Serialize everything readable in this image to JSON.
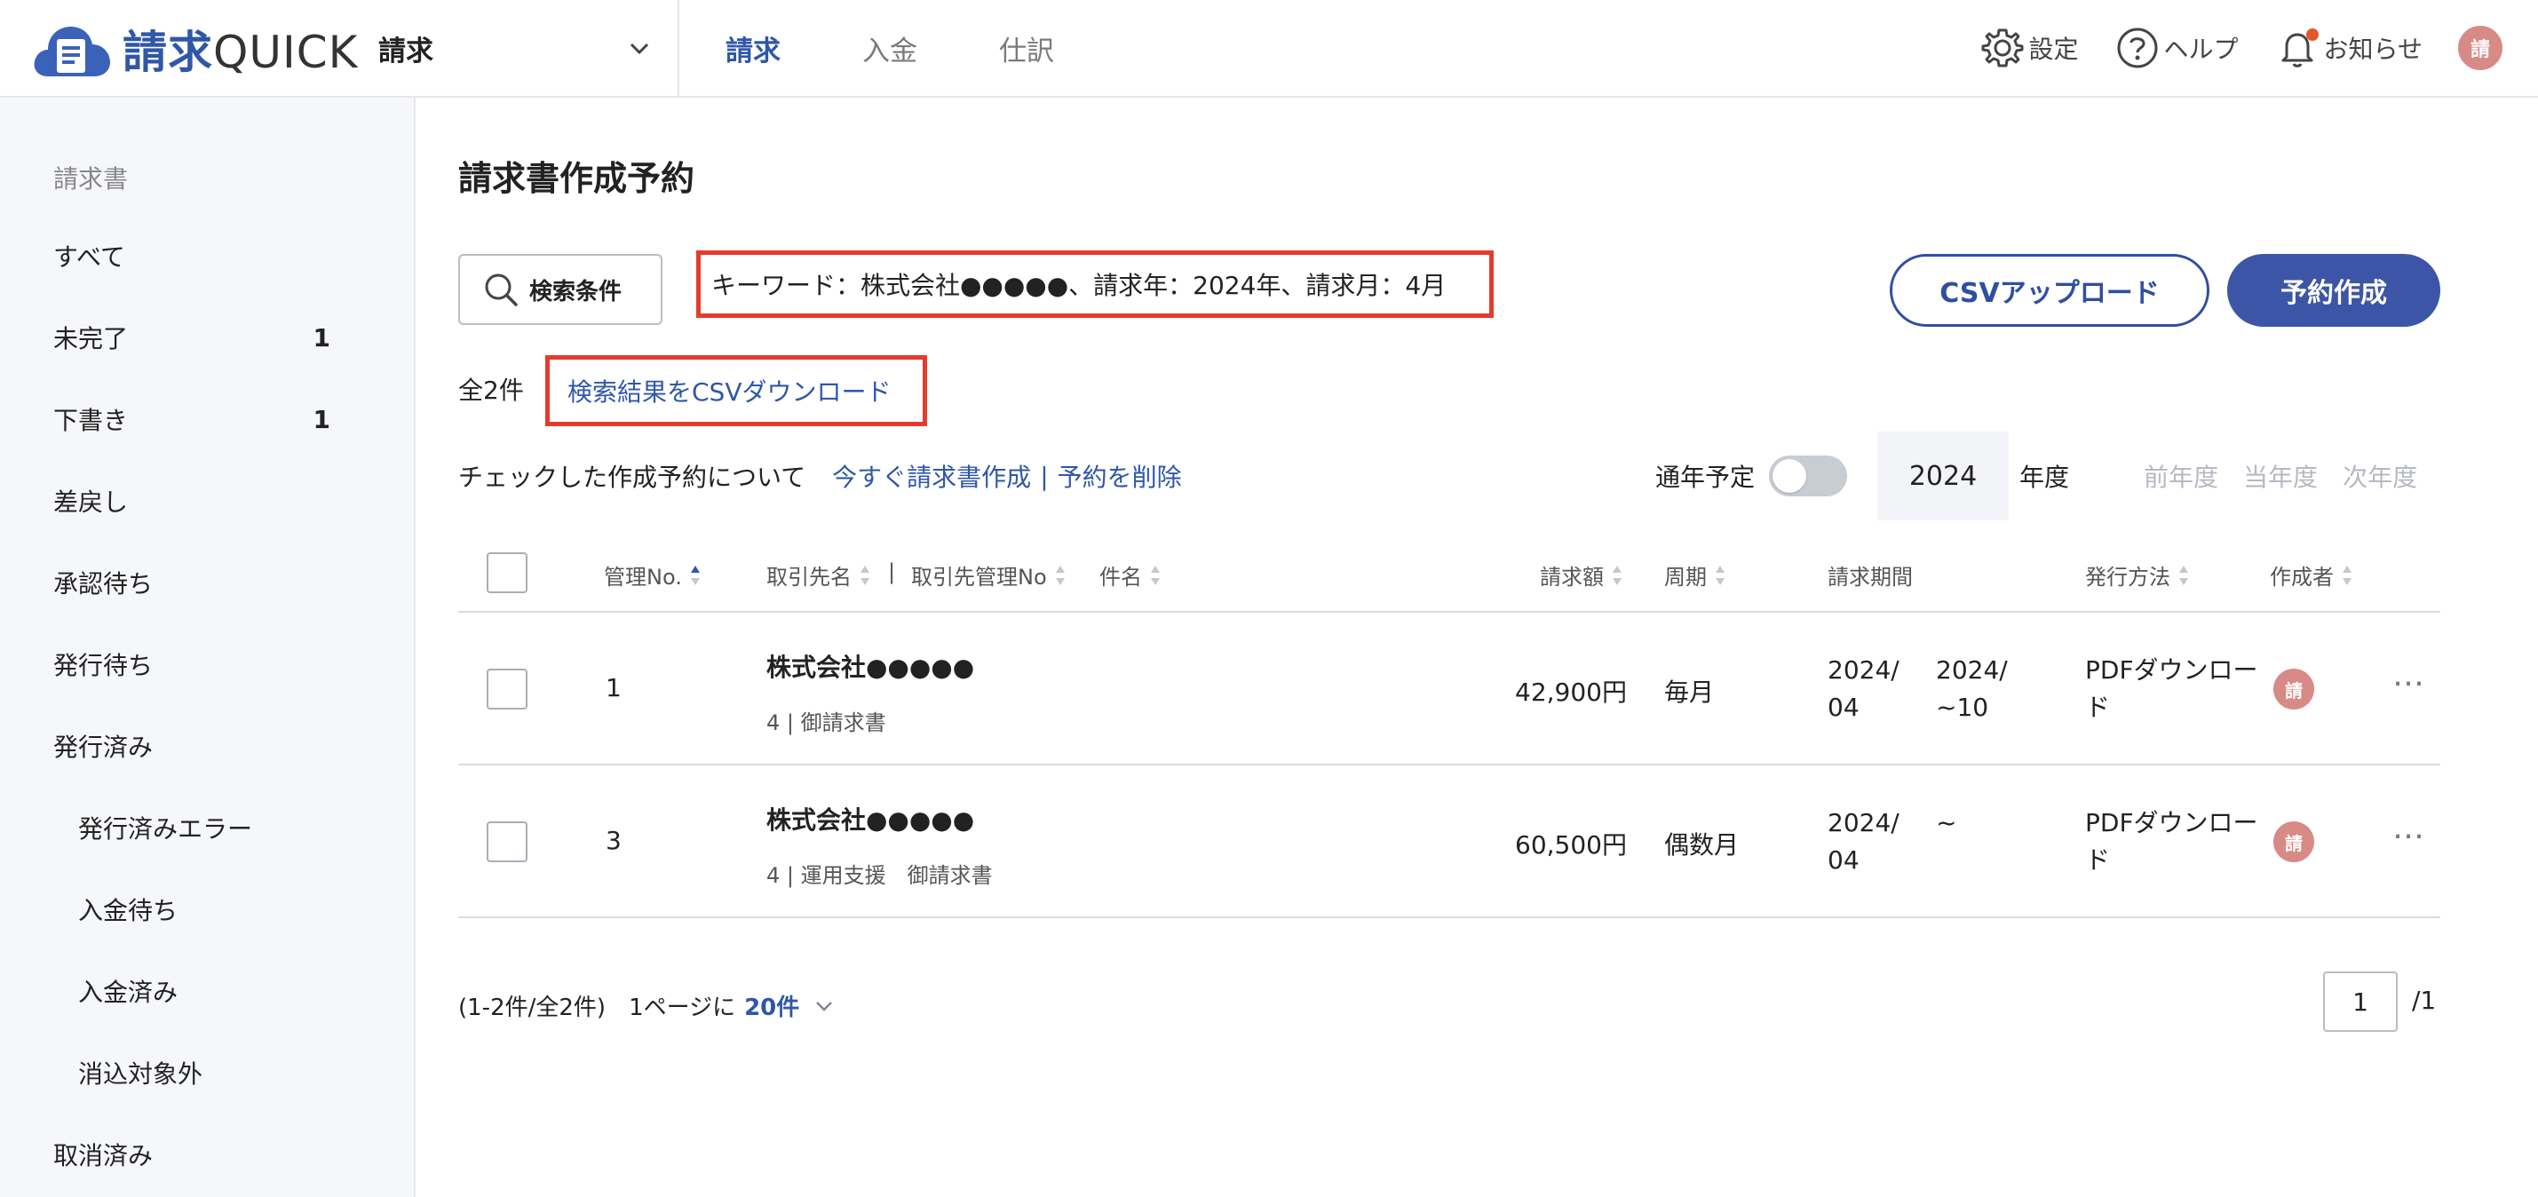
{
  "app": {
    "logo_prefix": "請求",
    "logo_suffix": "QUICK",
    "product_select": "請求"
  },
  "top_tabs": [
    {
      "label": "請求"
    },
    {
      "label": "入金"
    },
    {
      "label": "仕訳"
    }
  ],
  "header_right": {
    "settings": "設定",
    "help": "ヘルプ",
    "notifications": "お知らせ",
    "avatar": "請"
  },
  "sidebar": {
    "heading": "請求書",
    "items": [
      {
        "label": "すべて",
        "count": ""
      },
      {
        "label": "未完了",
        "count": "1"
      },
      {
        "label": "下書き",
        "count": "1"
      },
      {
        "label": "差戻し",
        "count": ""
      },
      {
        "label": "承認待ち",
        "count": ""
      },
      {
        "label": "発行待ち",
        "count": ""
      },
      {
        "label": "発行済み",
        "count": ""
      },
      {
        "label": "発行済みエラー",
        "count": ""
      },
      {
        "label": "入金待ち",
        "count": ""
      },
      {
        "label": "入金済み",
        "count": ""
      },
      {
        "label": "消込対象外",
        "count": ""
      },
      {
        "label": "取消済み",
        "count": ""
      }
    ]
  },
  "main": {
    "title": "請求書作成予約",
    "search_button": "検索条件",
    "keyword_summary": "キーワード：株式会社●●●●●、請求年：2024年、請求月：4月",
    "csv_upload": "CSVアップロード",
    "reserve_button": "予約作成",
    "total": "全2件",
    "csv_download": "検索結果をCSVダウンロード",
    "bulk_desc": "チェックした作成予約について",
    "bulk_create": "今すぐ請求書作成",
    "bulk_sep": "|",
    "bulk_delete": "予約を削除",
    "year_label": "通年予定",
    "year_value": "2024",
    "year_unit": "年度",
    "prev_year": "前年度",
    "current_year": "当年度",
    "next_year": "次年度"
  },
  "table": {
    "headers": {
      "no": "管理No.",
      "client": "取引先名",
      "sep": "|",
      "client_no": "取引先管理No",
      "subject": "件名",
      "amount": "請求額",
      "cycle": "周期",
      "period": "請求期間",
      "method": "発行方法",
      "creator": "作成者"
    },
    "rows": [
      {
        "no": "1",
        "client": "株式会社●●●●●",
        "sub": "4 | 御請求書",
        "amount": "42,900円",
        "cycle": "毎月",
        "period_start_1": "2024/",
        "period_start_2": "04",
        "period_end_1": "2024/",
        "period_end_2": "~10",
        "method": "PDFダウンロード",
        "creator": "請",
        "more": "…"
      },
      {
        "no": "3",
        "client": "株式会社●●●●●",
        "sub": "4 | 運用支援　御請求書",
        "amount": "60,500円",
        "cycle": "偶数月",
        "period_start_1": "2024/",
        "period_start_2": "04",
        "period_end_1": "",
        "period_end_2": "~",
        "method": "PDFダウンロード",
        "creator": "請",
        "more": "…"
      }
    ]
  },
  "pagination": {
    "range": "(1-2件/全2件)",
    "per_page_label": "1ページに",
    "per_page_value": "20件",
    "current_page": "1",
    "total_pages": "/1"
  },
  "colors": {
    "brand": "#2f57a8",
    "primary_button": "#3d55a6",
    "highlight_border": "#e53b2c",
    "avatar": "#d88a87"
  }
}
